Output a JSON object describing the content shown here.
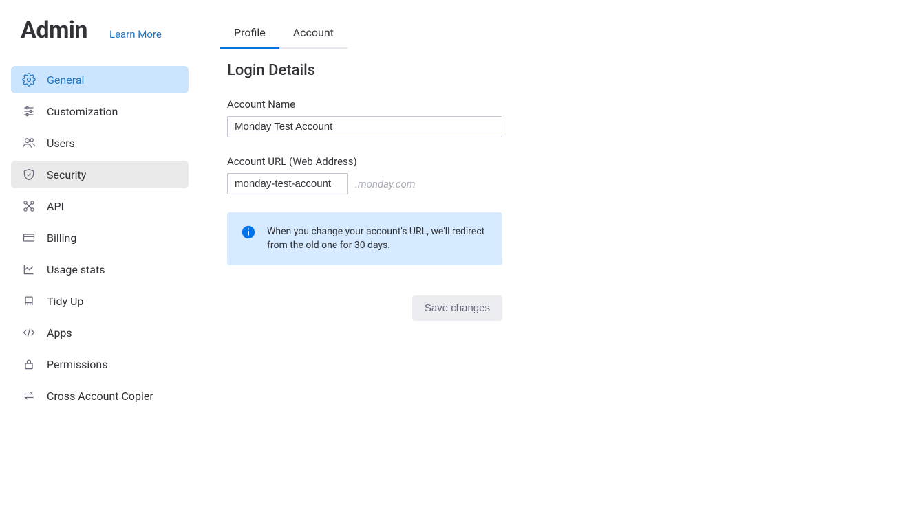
{
  "header": {
    "title": "Admin",
    "learn_more": "Learn More"
  },
  "sidebar": {
    "items": [
      {
        "label": "General"
      },
      {
        "label": "Customization"
      },
      {
        "label": "Users"
      },
      {
        "label": "Security"
      },
      {
        "label": "API"
      },
      {
        "label": "Billing"
      },
      {
        "label": "Usage stats"
      },
      {
        "label": "Tidy Up"
      },
      {
        "label": "Apps"
      },
      {
        "label": "Permissions"
      },
      {
        "label": "Cross Account Copier"
      }
    ]
  },
  "tabs": {
    "profile": "Profile",
    "account": "Account"
  },
  "section": {
    "title": "Login Details"
  },
  "form": {
    "account_name_label": "Account Name",
    "account_name_value": "Monday Test Account",
    "account_url_label": "Account URL (Web Address)",
    "account_url_value": "monday-test-account",
    "account_url_suffix": ".monday.com",
    "info_text": "When you change your account's URL, we'll redirect from the old one for 30 days.",
    "save_label": "Save changes"
  }
}
